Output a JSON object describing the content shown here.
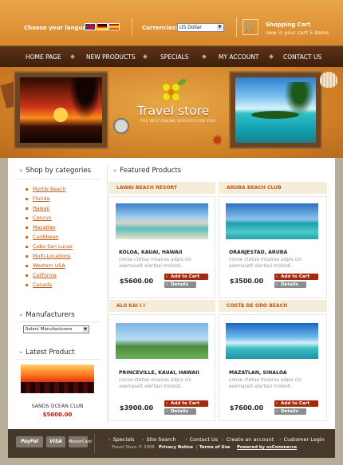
{
  "header": {
    "language_label": "Choose your language:",
    "currencies_label": "Currencies:",
    "currency_value": "US Dollar",
    "cart_title": "Shopping Cart",
    "cart_status": "now in your cart  5 items"
  },
  "nav": [
    "HOME PAGE",
    "NEW PRODUCTS",
    "SPECIALS",
    "MY ACCOUNT",
    "CONTACT US"
  ],
  "banner": {
    "title": "Travel store",
    "tagline": "THE BEST ONLINE SERVICES FOR YOU!"
  },
  "sidebar": {
    "categories_title": "Shop by categories",
    "categories": [
      "Myrtle Beach",
      "Florida",
      "Hawaii",
      "Cancun",
      "Mazatlan",
      "Caribbean",
      "Cabo San Lucas",
      "Multi-Locations",
      "Western USA",
      "California",
      "Canada"
    ],
    "manufacturers_title": "Manufacturers",
    "manufacturer_select": "Select Manufacturers",
    "latest_title": "Latest Product",
    "latest_name": "SANDS OCEAN CLUB",
    "latest_price": "$5000.00"
  },
  "featured": {
    "title": "Featured Products",
    "add_label": "Add to Cart",
    "details_label": "Details",
    "products": [
      {
        "head": "LAWAI BEACH RESORT",
        "name": "KOLOA, KAUAI, HAWAII",
        "desc": "conse ctetue msairas adpis cin asemaselt elertasi molesti.",
        "price": "$5600.00"
      },
      {
        "head": "ARUBA BEACH CLUB",
        "name": "ORANJESTAD, ARUBA",
        "desc": "conse ctetue msairas adpis cin asemaselt elertasi molesti.",
        "price": "$3500.00"
      },
      {
        "head": "ALII KAI I I",
        "name": "PRINCEVILLE, KAUAI, HAWAII",
        "desc": "conse ctetue msairas adpis cin asemaselt elertasi molesti.",
        "price": "$3900.00"
      },
      {
        "head": "COSTA DE ORO BEACH",
        "name": "MAZATLAN, SINALOA",
        "desc": "conse ctetue msairas adpis cin asemaselt elertasi molesti.",
        "price": "$7600.00"
      }
    ]
  },
  "footer": {
    "payments": [
      "PayPal",
      "VISA",
      "MasterCard"
    ],
    "links": [
      "Specials",
      "Site Search",
      "Contact Us",
      "Create an account",
      "Customer Login"
    ],
    "copyright": "Travel Store © 2008",
    "privacy": "Privacy Notice",
    "terms": "Terms of Use",
    "powered": "Powered by osCommerce"
  },
  "colors": {
    "accent": "#d5691b",
    "nav": "#4a260f",
    "price": "#c01a12",
    "button": "#a32a0f"
  }
}
